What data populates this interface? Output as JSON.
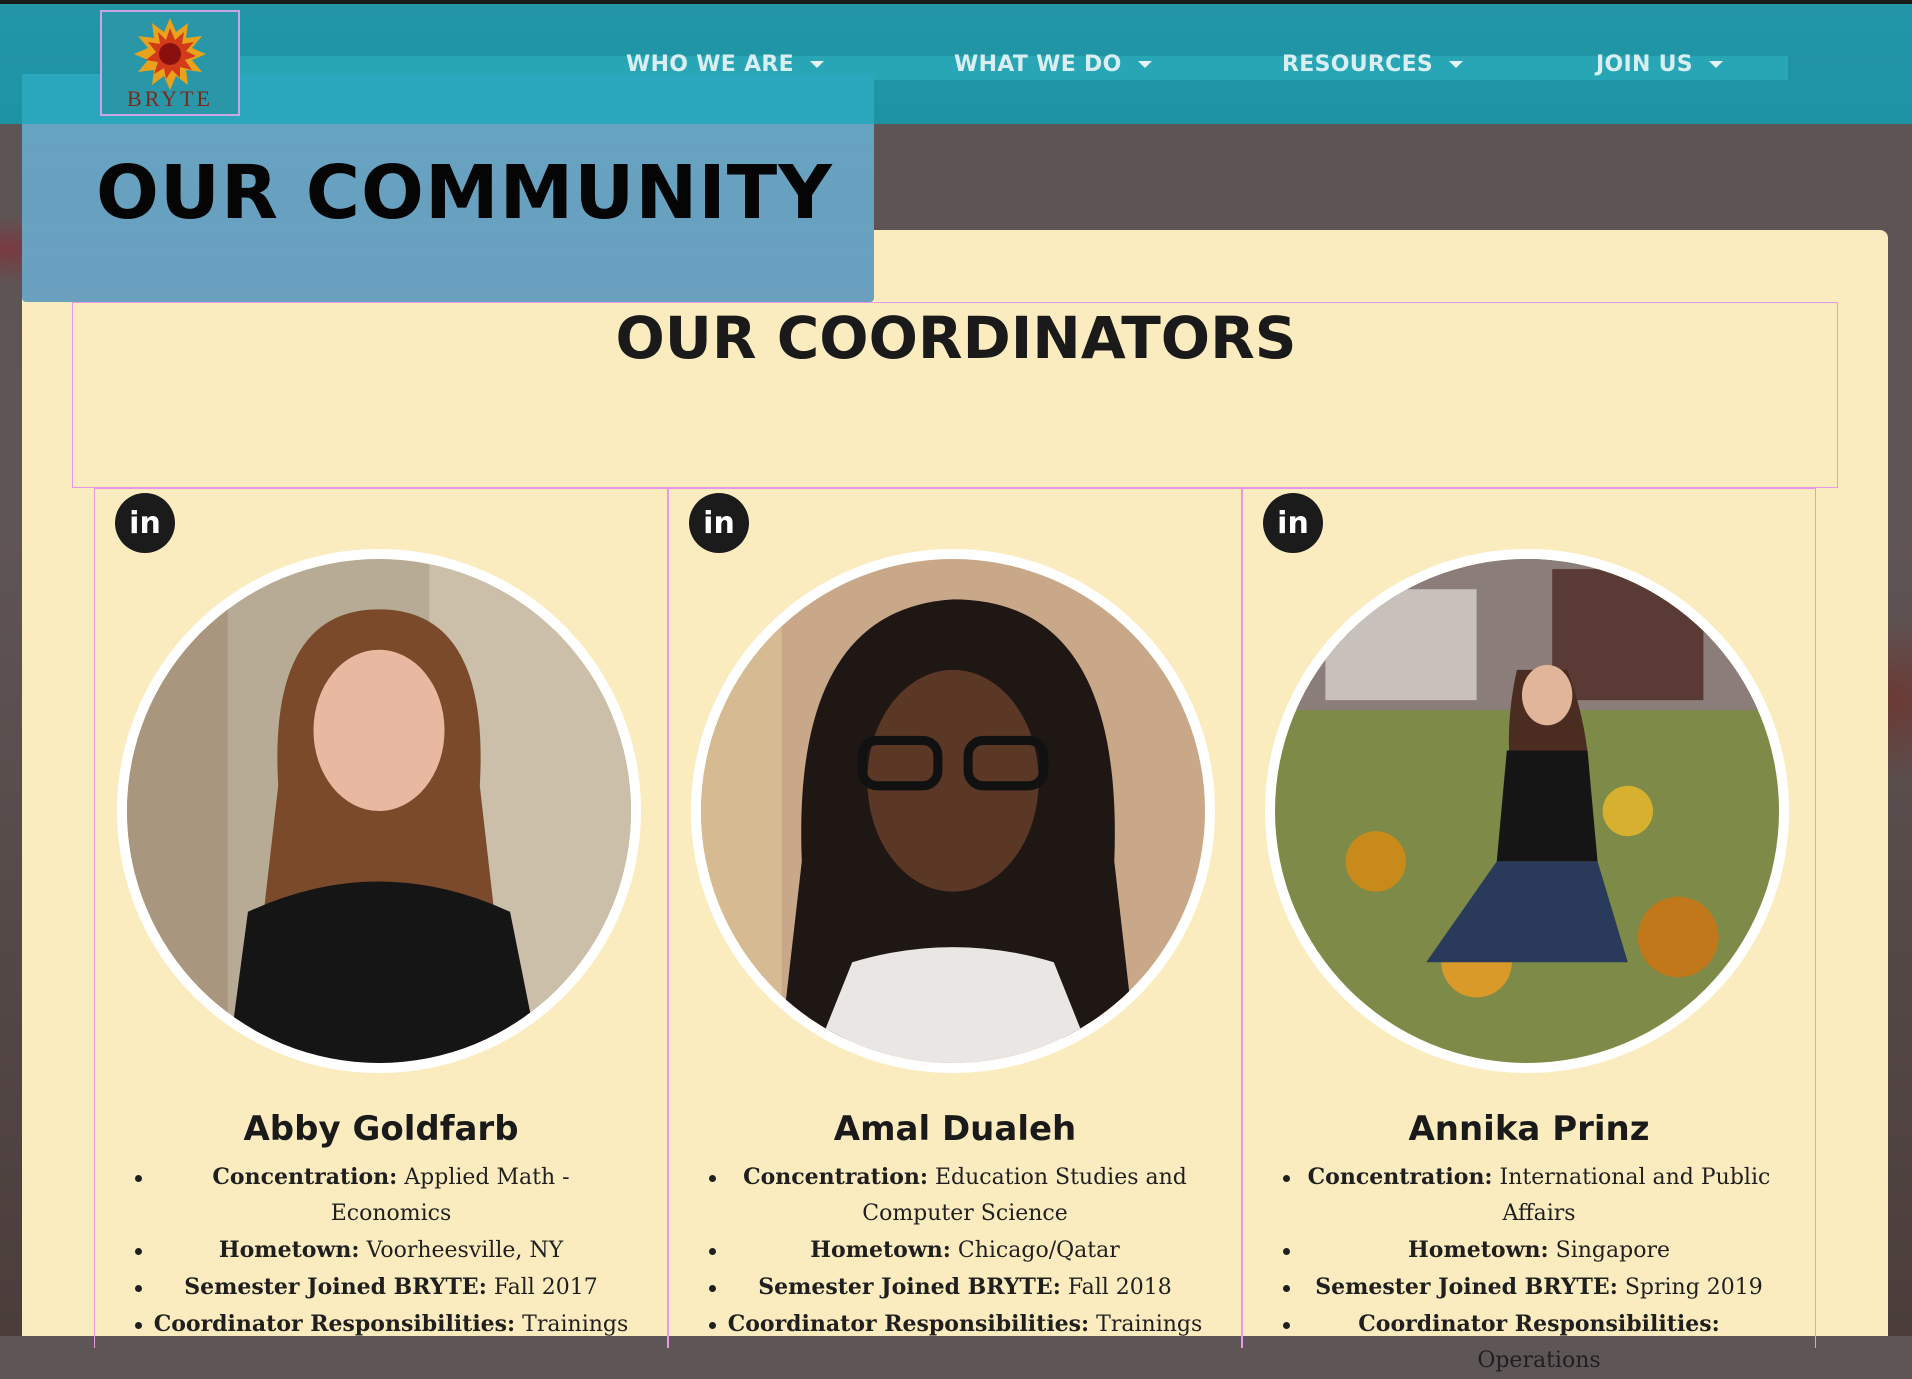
{
  "brand": {
    "logo_text": "BRYTE"
  },
  "nav": {
    "items": [
      {
        "label": "WHO WE ARE"
      },
      {
        "label": "WHAT WE DO"
      },
      {
        "label": "RESOURCES"
      },
      {
        "label": "JOIN US"
      }
    ]
  },
  "hero": {
    "title": "OUR COMMUNITY"
  },
  "section": {
    "heading": "OUR COORDINATORS"
  },
  "linkedin_icon_label": "in",
  "coordinators": [
    {
      "name": "Abby Goldfarb",
      "facts": [
        {
          "label": "Concentration:",
          "value": " Applied Math - Economics"
        },
        {
          "label": "Hometown:",
          "value": " Voorheesville, NY"
        },
        {
          "label": "Semester Joined BRYTE:",
          "value": " Fall 2017"
        },
        {
          "label": "Coordinator Responsibilities:",
          "value": " Trainings"
        }
      ]
    },
    {
      "name": "Amal Dualeh",
      "facts": [
        {
          "label": "Concentration:",
          "value": " Education Studies and Computer Science"
        },
        {
          "label": "Hometown:",
          "value": " Chicago/Qatar"
        },
        {
          "label": "Semester Joined BRYTE:",
          "value": " Fall 2018"
        },
        {
          "label": "Coordinator Responsibilities:",
          "value": " Trainings"
        }
      ]
    },
    {
      "name": "Annika Prinz",
      "facts": [
        {
          "label": "Concentration:",
          "value": " International and Public Affairs"
        },
        {
          "label": "Hometown:",
          "value": " Singapore"
        },
        {
          "label": "Semester Joined BRYTE:",
          "value": " Spring 2019"
        },
        {
          "label": "Coordinator Responsibilities:",
          "value": " Operations"
        }
      ]
    }
  ],
  "colors": {
    "header": "#1d93a4",
    "hero_box": "#6ba0bf",
    "panel": "#fbecc0",
    "outline": "#ec97e6",
    "logo_text": "#7a2a1a"
  }
}
